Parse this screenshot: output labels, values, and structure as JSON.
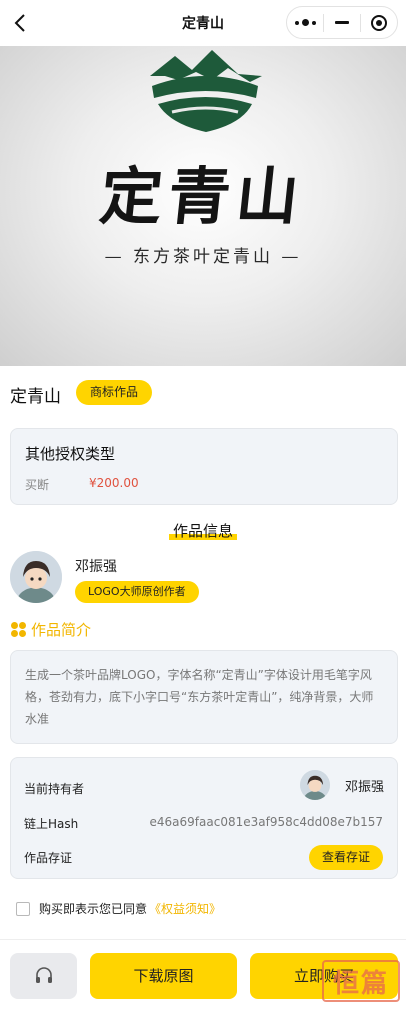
{
  "nav": {
    "title": "定青山",
    "icons": [
      "back-icon",
      "more-icon",
      "minimize-icon",
      "close-target-icon"
    ]
  },
  "hero": {
    "brand": "定青山",
    "slogan": "— 东方茶叶定青山 —",
    "colors": {
      "logo_green": "#1e5a3a",
      "background": "#e9e9e9"
    }
  },
  "work": {
    "title": "定青山",
    "tag": "商标作品"
  },
  "license": {
    "title": "其他授权类型",
    "type": "买断",
    "price": "¥200.00"
  },
  "info_section": {
    "heading": "作品信息"
  },
  "author": {
    "name": "邓振强",
    "badge": "LOGO大师原创作者"
  },
  "intro": {
    "heading": "作品简介",
    "text": "生成一个茶叶品牌LOGO，字体名称“定青山”字体设计用毛笔字风格，苍劲有力，底下小字口号“东方茶叶定青山”，纯净背景，大师水准"
  },
  "chain": {
    "owner_label": "当前持有者",
    "owner_name": "邓振强",
    "hash_label": "链上Hash",
    "hash_value": "e46a69faac081e3af958c4dd08e7b157",
    "proof_label": "作品存证",
    "proof_button": "查看存证"
  },
  "agree": {
    "prefix": "购买即表示您已同意",
    "link": "《权益须知》"
  },
  "bottom": {
    "service_icon": "headset-icon",
    "download": "下载原图",
    "buy": "立即购买"
  },
  "watermark": "恒篇",
  "theme": {
    "accent": "#ffd400",
    "price": "#e0523f",
    "link": "#f2b600",
    "card_bg": "#f1f4f8"
  }
}
